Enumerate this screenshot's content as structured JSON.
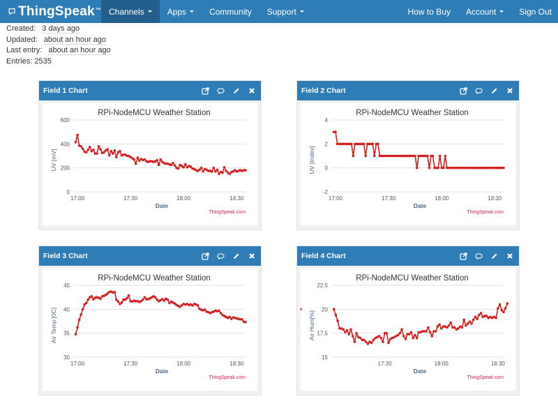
{
  "navbar": {
    "brand": "ThingSpeak",
    "brand_tm": "™",
    "items_left": [
      {
        "label": "Channels",
        "dropdown": true,
        "active": true
      },
      {
        "label": "Apps",
        "dropdown": true,
        "active": false
      },
      {
        "label": "Community",
        "dropdown": false,
        "active": false
      },
      {
        "label": "Support",
        "dropdown": true,
        "active": false
      }
    ],
    "items_right": [
      {
        "label": "How to Buy",
        "dropdown": false
      },
      {
        "label": "Account",
        "dropdown": true
      },
      {
        "label": "Sign Out",
        "dropdown": false
      }
    ]
  },
  "channel_meta": {
    "created_label": "Created:",
    "created_value": "3 days ago",
    "updated_label": "Updated:",
    "updated_value": "about an hour ago",
    "last_entry_label": "Last entry:",
    "last_entry_value": "about an hour ago",
    "entries_label": "Entries:",
    "entries_value": "2535"
  },
  "panel_icons": [
    "external-link-icon",
    "comment-icon",
    "pencil-icon",
    "close-icon"
  ],
  "colors": {
    "nav_bg": "#2f7db6",
    "nav_active": "#235f8c",
    "series": "#d62020",
    "credit": "#d62050",
    "axis_label": "#4a6785"
  },
  "chart_data": [
    {
      "panel_title": "Field 1 Chart",
      "type": "line",
      "title": "RPi-NodeMCU Weather Station",
      "xlabel": "Date",
      "ylabel": "UV [mV]",
      "credit": "ThingSpeak.com",
      "xlim": [
        "16:58",
        "18:35"
      ],
      "xticks": [
        "17:00",
        "17:30",
        "18:00",
        "18:30"
      ],
      "ylim": [
        0,
        600
      ],
      "yticks": [
        0,
        200,
        400,
        600
      ],
      "grid": true,
      "legend": "none",
      "x_minutes_from_1700": [
        -1,
        0,
        1,
        2,
        3,
        4,
        5,
        6,
        7,
        8,
        9,
        10,
        11,
        12,
        13,
        14,
        15,
        16,
        17,
        18,
        19,
        20,
        21,
        22,
        23,
        24,
        25,
        26,
        27,
        28,
        29,
        30,
        31,
        32,
        33,
        34,
        35,
        36,
        37,
        38,
        39,
        40,
        41,
        42,
        43,
        44,
        45,
        46,
        47,
        48,
        49,
        50,
        51,
        52,
        53,
        54,
        55,
        56,
        57,
        58,
        59,
        60,
        61,
        62,
        63,
        64,
        65,
        66,
        67,
        68,
        69,
        70,
        71,
        72,
        73,
        74,
        75,
        76,
        77,
        78,
        79,
        80,
        81,
        82,
        83,
        84,
        85,
        86,
        87,
        88,
        89,
        90,
        91,
        92,
        93,
        94,
        95
      ],
      "values": [
        415,
        475,
        385,
        380,
        360,
        335,
        330,
        350,
        375,
        340,
        350,
        320,
        320,
        380,
        355,
        325,
        330,
        345,
        355,
        305,
        340,
        320,
        345,
        290,
        330,
        340,
        305,
        310,
        310,
        300,
        300,
        290,
        280,
        270,
        235,
        285,
        260,
        275,
        265,
        270,
        255,
        250,
        255,
        255,
        250,
        255,
        265,
        225,
        270,
        250,
        240,
        235,
        235,
        230,
        225,
        240,
        220,
        200,
        195,
        225,
        215,
        205,
        230,
        205,
        215,
        210,
        195,
        190,
        180,
        175,
        185,
        200,
        170,
        190,
        185,
        175,
        175,
        170,
        200,
        170,
        185,
        150,
        165,
        160,
        205,
        175,
        160,
        150,
        165,
        170,
        180,
        170,
        175,
        180,
        175,
        180,
        180
      ]
    },
    {
      "panel_title": "Field 2 Chart",
      "type": "line",
      "title": "RPi-NodeMCU Weather Station",
      "xlabel": "Date",
      "ylabel": "UV [Index]",
      "credit": "ThingSpeak.com",
      "xlim": [
        "16:58",
        "18:35"
      ],
      "xticks": [
        "17:00",
        "17:30",
        "18:00",
        "18:30"
      ],
      "ylim": [
        -2,
        4
      ],
      "yticks": [
        -2,
        0,
        2,
        4
      ],
      "grid": true,
      "legend": "none",
      "x_minutes_from_1700": [
        -1,
        0,
        1,
        2,
        3,
        4,
        5,
        6,
        7,
        8,
        9,
        10,
        11,
        12,
        13,
        14,
        15,
        16,
        17,
        18,
        19,
        20,
        21,
        22,
        23,
        24,
        25,
        26,
        27,
        28,
        29,
        30,
        31,
        32,
        33,
        34,
        35,
        36,
        37,
        38,
        39,
        40,
        41,
        42,
        43,
        44,
        45,
        46,
        47,
        48,
        49,
        50,
        51,
        52,
        53,
        54,
        55,
        56,
        57,
        58,
        59,
        60,
        61,
        62,
        63,
        64,
        65,
        66,
        67,
        68,
        69,
        70,
        71,
        72,
        73,
        74,
        75,
        76,
        77,
        78,
        79,
        80,
        81,
        82,
        83,
        84,
        85,
        86,
        87,
        88,
        89,
        90,
        91,
        92,
        93,
        94,
        95
      ],
      "values": [
        3,
        3,
        2,
        2,
        2,
        2,
        2,
        2,
        2,
        2,
        2,
        1,
        2,
        2,
        2,
        2,
        2,
        2,
        1,
        2,
        2,
        2,
        2,
        1,
        2,
        2,
        1,
        1,
        1,
        1,
        1,
        1,
        1,
        1,
        1,
        1,
        1,
        1,
        1,
        1,
        1,
        1,
        1,
        1,
        1,
        1,
        1,
        0,
        1,
        1,
        1,
        1,
        1,
        1,
        0,
        1,
        1,
        0,
        0,
        0,
        1,
        0,
        0,
        1,
        0,
        0,
        0,
        0,
        0,
        0,
        0,
        0,
        0,
        0,
        0,
        0,
        0,
        0,
        0,
        0,
        0,
        0,
        0,
        0,
        0,
        0,
        0,
        0,
        0,
        0,
        0,
        0,
        0,
        0,
        0,
        0,
        0
      ]
    },
    {
      "panel_title": "Field 3 Chart",
      "type": "line",
      "title": "RPi-NodeMCU Weather Station",
      "xlabel": "Date",
      "ylabel": "Air Temp [0C]",
      "credit": "ThingSpeak.com",
      "xlim": [
        "16:58",
        "18:35"
      ],
      "xticks": [
        "17:00",
        "17:30",
        "18:00",
        "18:30"
      ],
      "ylim": [
        30,
        45
      ],
      "yticks": [
        30,
        35,
        40,
        45
      ],
      "grid": true,
      "legend": "none",
      "x_minutes_from_1700": [
        -1,
        0,
        1,
        2,
        3,
        4,
        5,
        6,
        7,
        8,
        9,
        10,
        11,
        12,
        13,
        14,
        15,
        16,
        17,
        18,
        19,
        20,
        21,
        22,
        23,
        24,
        25,
        26,
        27,
        28,
        29,
        30,
        31,
        32,
        33,
        34,
        35,
        36,
        37,
        38,
        39,
        40,
        41,
        42,
        43,
        44,
        45,
        46,
        47,
        48,
        49,
        50,
        51,
        52,
        53,
        54,
        55,
        56,
        57,
        58,
        59,
        60,
        61,
        62,
        63,
        64,
        65,
        66,
        67,
        68,
        69,
        70,
        71,
        72,
        73,
        74,
        75,
        76,
        77,
        78,
        79,
        80,
        81,
        82,
        83,
        84,
        85,
        86,
        87,
        88,
        89,
        90,
        91,
        92,
        93,
        94,
        95
      ],
      "values": [
        34.8,
        36.2,
        37.8,
        38.9,
        40.0,
        41.0,
        41.3,
        42.0,
        42.5,
        42.7,
        42.1,
        42.4,
        42.5,
        42.4,
        42.2,
        42.7,
        42.8,
        43.0,
        43.3,
        43.6,
        43.7,
        43.5,
        43.6,
        42.0,
        41.6,
        41.1,
        41.4,
        42.0,
        42.0,
        42.3,
        42.9,
        41.7,
        41.6,
        41.8,
        41.7,
        41.7,
        41.5,
        41.7,
        42.0,
        42.5,
        42.1,
        42.1,
        42.3,
        42.5,
        42.7,
        42.5,
        42.0,
        41.7,
        41.9,
        42.1,
        41.8,
        42.2,
        42.0,
        41.3,
        41.6,
        41.4,
        41.2,
        40.9,
        40.7,
        40.5,
        40.8,
        41.1,
        41.0,
        41.1,
        40.9,
        41.0,
        40.8,
        41.1,
        41.0,
        40.8,
        40.1,
        39.9,
        39.8,
        39.9,
        39.5,
        39.4,
        39.2,
        39.4,
        39.5,
        39.7,
        39.6,
        39.7,
        39.2,
        38.8,
        38.6,
        38.4,
        38.2,
        38.4,
        38.0,
        38.3,
        38.2,
        38.1,
        38.0,
        37.9,
        37.9,
        37.4,
        37.3
      ]
    },
    {
      "panel_title": "Field 4 Chart",
      "type": "line",
      "title": "RPi-NodeMCU Weather Station",
      "xlabel": "Date",
      "ylabel": "Air Hum[%]",
      "credit": "ThingSpeak.com",
      "xlim": [
        "17:02",
        "18:33"
      ],
      "xticks": [
        "17:30",
        "18:00",
        "18:30"
      ],
      "ylim": [
        15,
        22.5
      ],
      "yticks": [
        15,
        17.5,
        20,
        22.5
      ],
      "grid": true,
      "legend": "none",
      "x_minutes_from_1700": [
        3,
        4,
        5,
        6,
        7,
        8,
        9,
        10,
        11,
        12,
        13,
        14,
        15,
        16,
        17,
        18,
        19,
        20,
        21,
        22,
        23,
        24,
        25,
        26,
        27,
        28,
        29,
        30,
        31,
        32,
        33,
        34,
        35,
        36,
        37,
        38,
        39,
        40,
        41,
        42,
        43,
        44,
        45,
        46,
        47,
        48,
        49,
        50,
        51,
        52,
        53,
        54,
        55,
        56,
        57,
        58,
        59,
        60,
        61,
        62,
        63,
        64,
        65,
        66,
        67,
        68,
        69,
        70,
        71,
        72,
        73,
        74,
        75,
        76,
        77,
        78,
        79,
        80,
        81,
        82,
        83,
        84,
        85,
        86,
        87,
        88,
        89,
        90,
        91,
        92,
        93,
        94,
        95
      ],
      "values": [
        20.0,
        19.4,
        18.8,
        18.0,
        18.0,
        17.9,
        17.6,
        17.8,
        17.4,
        17.9,
        17.2,
        16.6,
        17.5,
        17.1,
        17.0,
        16.8,
        16.8,
        16.6,
        16.4,
        16.6,
        16.5,
        16.8,
        17.0,
        17.1,
        17.2,
        17.0,
        16.6,
        17.5,
        17.5,
        16.5,
        16.9,
        17.0,
        17.1,
        17.2,
        17.3,
        17.5,
        17.9,
        17.2,
        16.9,
        17.4,
        17.4,
        17.6,
        17.0,
        17.3,
        17.0,
        17.6,
        17.6,
        17.7,
        17.7,
        17.7,
        18.1,
        17.6,
        17.2,
        17.7,
        17.7,
        18.2,
        18.4,
        18.0,
        18.2,
        18.2,
        18.1,
        18.3,
        18.6,
        18.1,
        18.1,
        17.9,
        18.0,
        18.2,
        18.1,
        18.9,
        18.3,
        18.5,
        18.7,
        18.5,
        18.9,
        19.2,
        19.0,
        19.4,
        19.6,
        19.2,
        19.3,
        19.3,
        19.1,
        19.2,
        19.1,
        19.2,
        19.1,
        20.1,
        20.5,
        19.9,
        19.7,
        20.1,
        20.6,
        20.0
      ]
    }
  ]
}
